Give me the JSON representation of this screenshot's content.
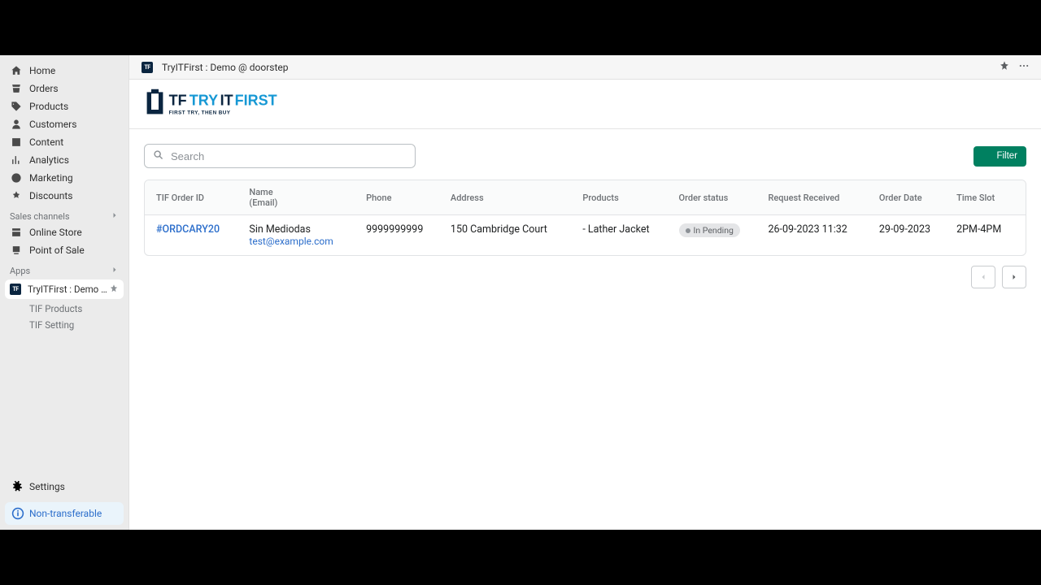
{
  "topbar": {
    "title": "TryITFirst : Demo @ doorstep"
  },
  "sidebar": {
    "items": [
      {
        "label": "Home"
      },
      {
        "label": "Orders"
      },
      {
        "label": "Products"
      },
      {
        "label": "Customers"
      },
      {
        "label": "Content"
      },
      {
        "label": "Analytics"
      },
      {
        "label": "Marketing"
      },
      {
        "label": "Discounts"
      }
    ],
    "sales_channels_label": "Sales channels",
    "channels": [
      {
        "label": "Online Store"
      },
      {
        "label": "Point of Sale"
      }
    ],
    "apps_label": "Apps",
    "active_app": "TryITFirst : Demo @ d...",
    "app_subs": [
      {
        "label": "TIF Products"
      },
      {
        "label": "TIF Setting"
      }
    ],
    "settings_label": "Settings",
    "non_transferable_label": "Non-transferable"
  },
  "logo": {
    "brand": "TRYITFIRST",
    "tagline": "FIRST TRY, THEN BUY"
  },
  "search": {
    "placeholder": "Search"
  },
  "filter": {
    "label": "Filter"
  },
  "table": {
    "headers": {
      "order_id": "TIF Order ID",
      "name_line1": "Name",
      "name_line2": "(Email)",
      "phone": "Phone",
      "address": "Address",
      "products": "Products",
      "status": "Order status",
      "received": "Request Received",
      "order_date": "Order Date",
      "time_slot": "Time Slot"
    },
    "rows": [
      {
        "order_id": "#ORDCARY20",
        "name": "Sin Mediodas",
        "email": "test@example.com",
        "phone": "9999999999",
        "address": "150 Cambridge Court",
        "products": "- Lather Jacket",
        "status": "In Pending",
        "received": "26-09-2023 11:32",
        "order_date": "29-09-2023",
        "time_slot": "2PM-4PM"
      }
    ]
  }
}
